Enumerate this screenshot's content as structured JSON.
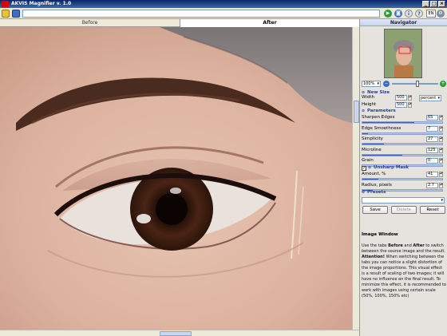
{
  "window": {
    "title": "AKVIS Magnifier v. 1.0",
    "controls": [
      "_",
      "□",
      "×"
    ]
  },
  "toolbar": {
    "open_icon": "open-folder-icon",
    "save_icon": "save-disk-icon",
    "file_path": "",
    "run_icon": "run-icon",
    "stop_icon": "stop-icon",
    "info_icon": "info-icon",
    "help_icon": "help-icon",
    "settings_icon": "settings-icon",
    "language": "EN",
    "plugin_icon": "plugin-icon"
  },
  "tabs": [
    {
      "label": "Before",
      "active": false
    },
    {
      "label": "After",
      "active": true
    }
  ],
  "navigator": {
    "title": "Navigator",
    "zoom": "100%",
    "zoom_level_fraction": 0.55
  },
  "new_size": {
    "title": "New Size",
    "width_label": "Width",
    "width_value": "500",
    "height_label": "Height",
    "height_value": "500",
    "unit": "percent"
  },
  "parameters": {
    "title": "Parameters",
    "items": [
      {
        "label": "Sharpen Edges",
        "value": "65",
        "fraction": 0.65
      },
      {
        "label": "Edge Smoothness",
        "value": "7",
        "fraction": 0.07
      },
      {
        "label": "Simplicity",
        "value": "27",
        "fraction": 0.27
      },
      {
        "label": "Microline",
        "value": "125",
        "fraction": 0.5
      },
      {
        "label": "Grain",
        "value": "0",
        "fraction": 0.0
      }
    ]
  },
  "unsharp_mask": {
    "title": "Unsharp Mask",
    "enabled": true,
    "items": [
      {
        "label": "Amount, %",
        "value": "41",
        "fraction": 0.2
      },
      {
        "label": "Radius, pixels",
        "value": "2.7",
        "fraction": 0.13
      }
    ]
  },
  "presets": {
    "title": "Presets",
    "selected": "",
    "buttons": {
      "save": "Save",
      "delete": "Delete",
      "reset": "Reset"
    }
  },
  "help": {
    "title": "Image Window",
    "text_parts": [
      {
        "t": "Use the tabs ",
        "b": false
      },
      {
        "t": "Before",
        "b": true
      },
      {
        "t": " and ",
        "b": false
      },
      {
        "t": "After",
        "b": true
      },
      {
        "t": " to switch between the source image and the result. ",
        "b": false
      },
      {
        "t": "Attention!",
        "b": true
      },
      {
        "t": " When switching between the tabs you can notice a slight distortion of the image proportions. This visual effect is a result of scaling of two images; it will have no influence on the final result. To minimize this effect, it is recommended to work with images using certain scale (50%, 100%, 150% etc)",
        "b": false
      }
    ]
  }
}
